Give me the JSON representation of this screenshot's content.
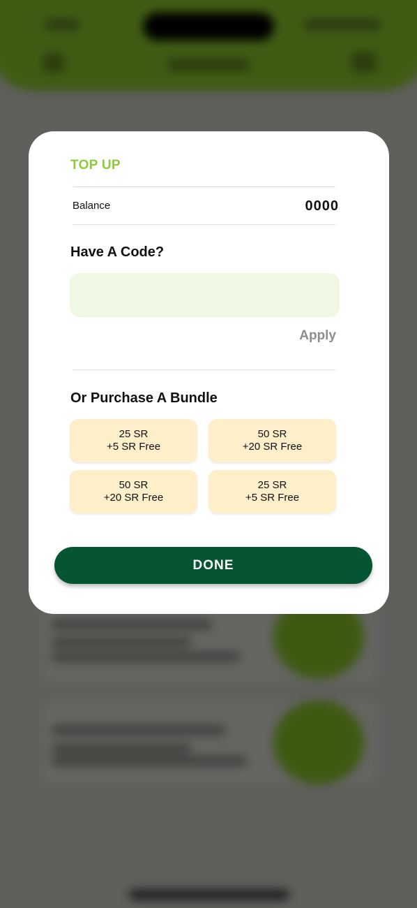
{
  "modal": {
    "title": "TOP UP",
    "balance_label": "Balance",
    "balance_value": "0000",
    "code_heading": "Have A Code?",
    "code_input_value": "",
    "code_input_placeholder": "",
    "apply_label": "Apply",
    "bundle_heading": "Or Purchase A Bundle",
    "bundles": [
      {
        "amount": "25 SR",
        "bonus": "+5 SR Free"
      },
      {
        "amount": "50 SR",
        "bonus": "+20 SR Free"
      },
      {
        "amount": "50 SR",
        "bonus": "+20 SR Free"
      },
      {
        "amount": "25 SR",
        "bonus": "+5 SR Free"
      }
    ],
    "done_label": "DONE"
  },
  "colors": {
    "title_accent": "#8ccc3c",
    "input_background": "#eef8e2",
    "bundle_background": "#fdefc9",
    "done_button": "#065532",
    "header_background": "#3f5c14"
  }
}
